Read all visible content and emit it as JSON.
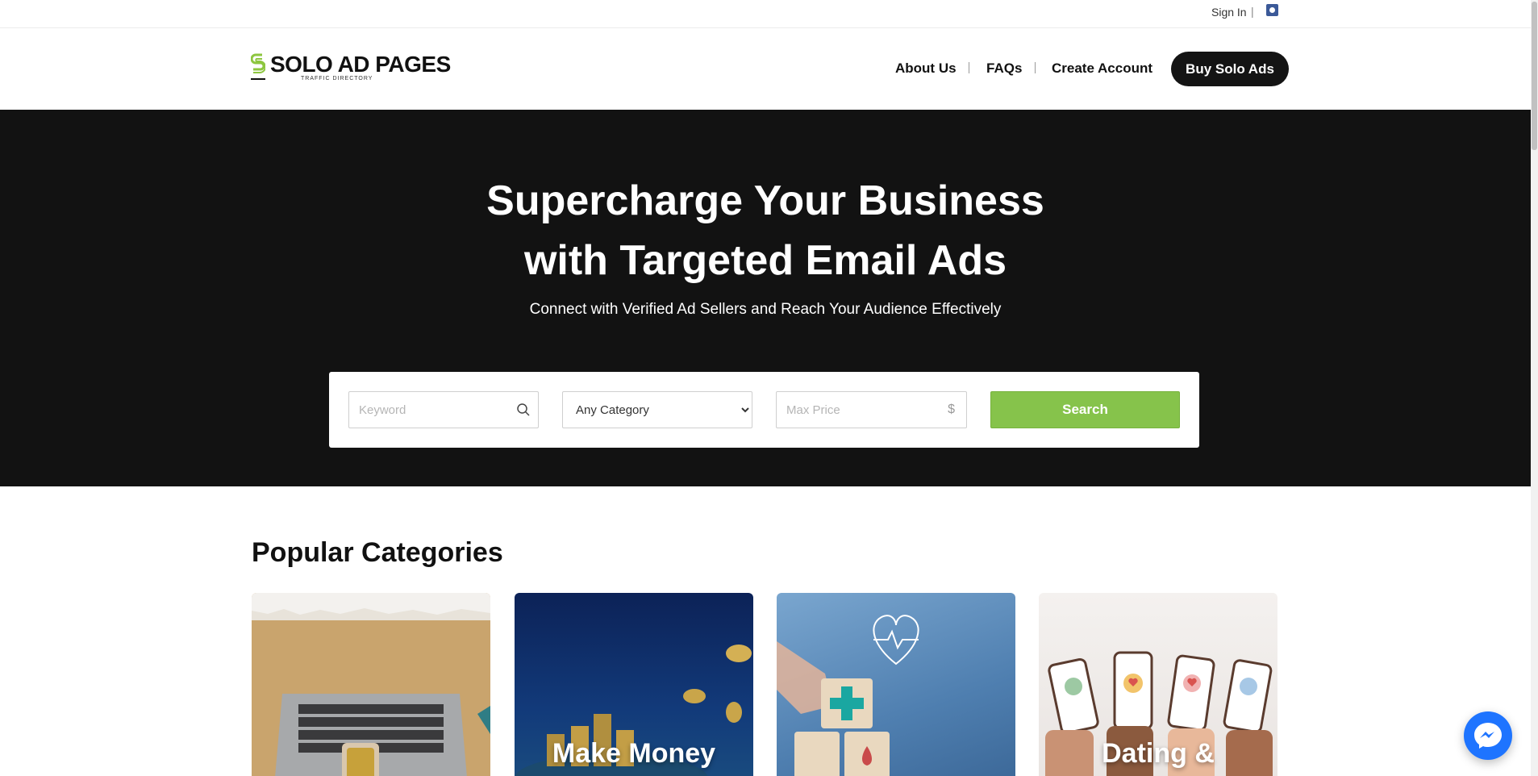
{
  "topbar": {
    "signin_label": "Sign In",
    "separator": "|",
    "social_icon": "facebook-icon"
  },
  "header": {
    "logo": {
      "title": "SOLO AD PAGES",
      "subtitle": "TRAFFIC DIRECTORY",
      "accent_color": "#8dc63f"
    },
    "nav": {
      "about": "About Us",
      "faqs": "FAQs",
      "create_account": "Create Account",
      "buy": "Buy Solo Ads"
    }
  },
  "hero": {
    "title_line1": "Supercharge Your Business",
    "title_line2": "with Targeted Email Ads",
    "subtitle": "Connect with Verified Ad Sellers and Reach Your Audience Effectively",
    "search": {
      "keyword_placeholder": "Keyword",
      "category_selected": "Any Category",
      "price_placeholder": "Max Price",
      "currency_symbol": "$",
      "button_label": "Search",
      "button_color": "#86c34b"
    }
  },
  "categories": {
    "title": "Popular Categories",
    "items": [
      {
        "label": "",
        "image": "laptop-desk-image"
      },
      {
        "label": "Make Money",
        "image": "coins-image"
      },
      {
        "label": "",
        "image": "health-cross-image"
      },
      {
        "label": "Dating &",
        "image": "phones-hearts-image"
      }
    ]
  },
  "chat": {
    "icon": "messenger-icon",
    "color": "#1e74ff"
  }
}
